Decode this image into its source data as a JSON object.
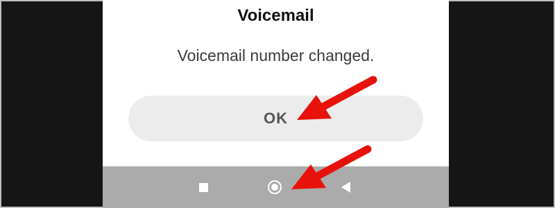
{
  "dialog": {
    "title": "Voicemail",
    "message": "Voicemail number changed.",
    "ok_label": "OK"
  },
  "navbar": {
    "recent_icon": "square-recent-apps-icon",
    "home_icon": "circle-home-icon",
    "back_icon": "triangle-back-icon",
    "background": "#ababab"
  },
  "annotations": {
    "arrow_color": "#e8120c"
  }
}
